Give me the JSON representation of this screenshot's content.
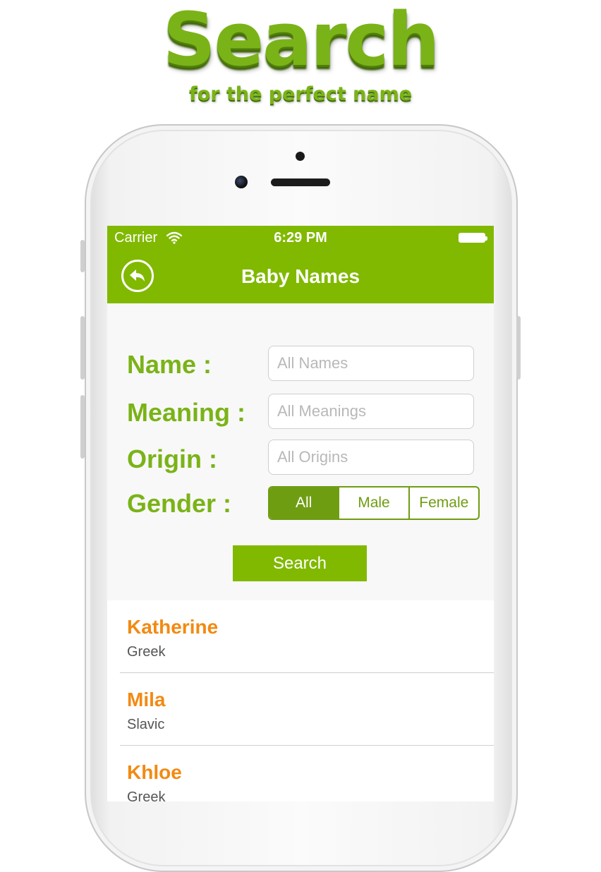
{
  "promo": {
    "title": "Search",
    "subtitle": "for the perfect name"
  },
  "status_bar": {
    "carrier": "Carrier",
    "time": "6:29 PM",
    "icons": [
      "wifi-icon",
      "battery-icon"
    ]
  },
  "nav": {
    "title": "Baby Names",
    "back_icon": "back-arrow-icon"
  },
  "form": {
    "name_label": "Name :",
    "name_placeholder": "All Names",
    "meaning_label": "Meaning :",
    "meaning_placeholder": "All Meanings",
    "origin_label": "Origin :",
    "origin_placeholder": "All Origins",
    "gender_label": "Gender :",
    "gender_options": [
      "All",
      "Male",
      "Female"
    ],
    "gender_selected": "All",
    "search_label": "Search"
  },
  "results": [
    {
      "name": "Katherine",
      "origin": "Greek"
    },
    {
      "name": "Mila",
      "origin": "Slavic"
    },
    {
      "name": "Khloe",
      "origin": "Greek"
    }
  ],
  "colors": {
    "brand_green": "#80b900",
    "label_green": "#7ab317",
    "segment_green": "#6f9d12",
    "name_orange": "#f28a12"
  }
}
